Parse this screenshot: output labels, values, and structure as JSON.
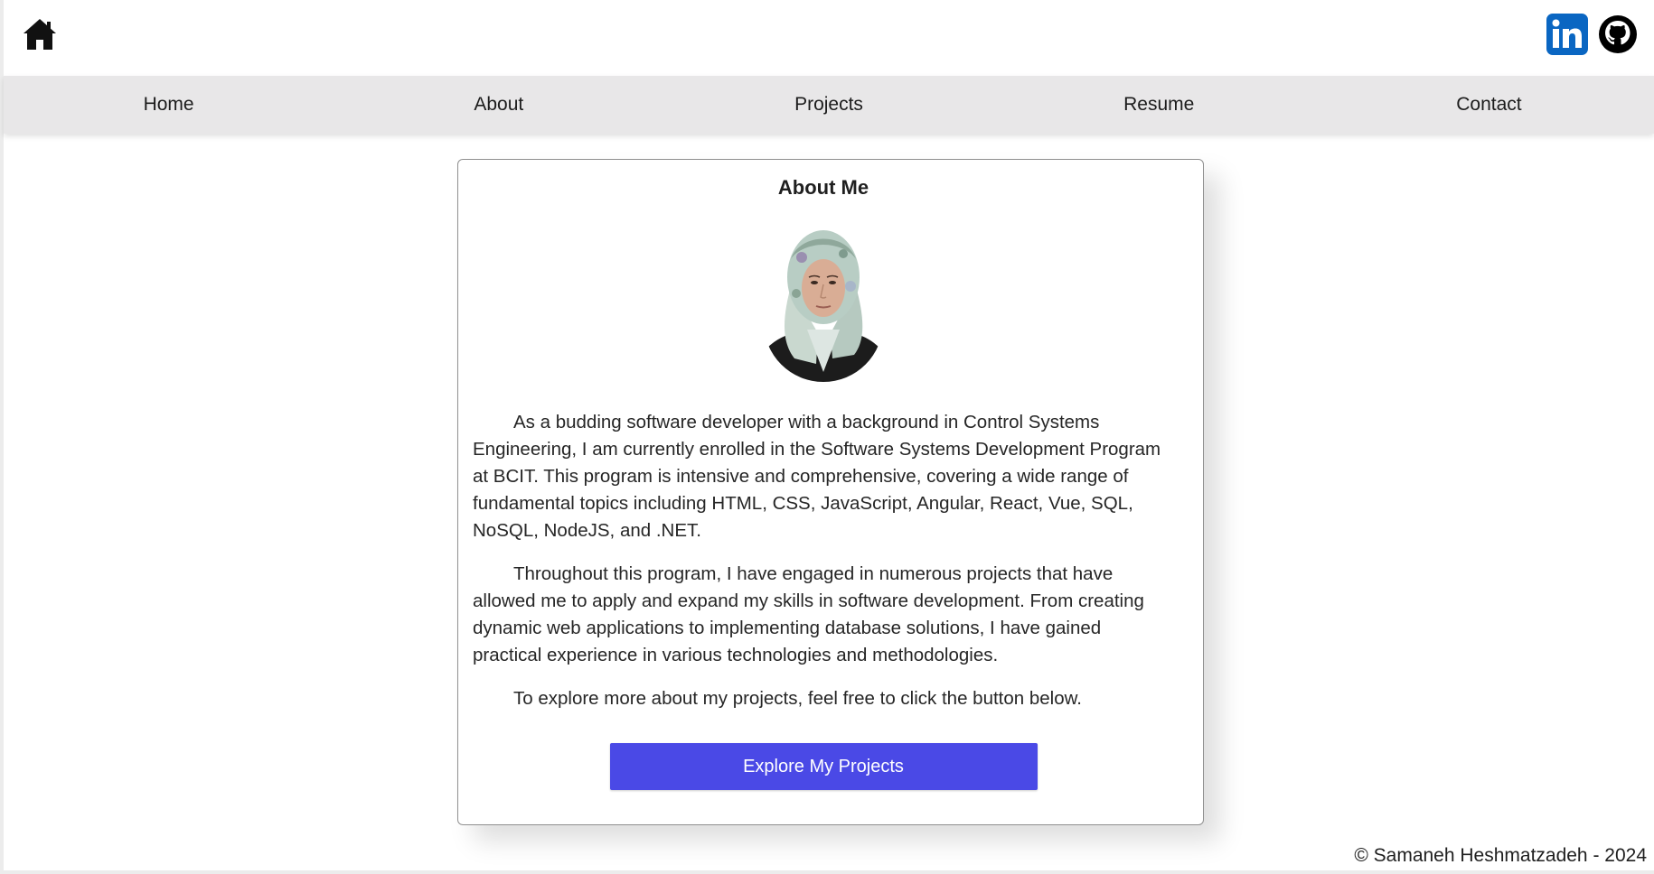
{
  "header": {
    "home_icon": "home-icon",
    "social": [
      {
        "name": "linkedin-icon",
        "color": "#0a66c2"
      },
      {
        "name": "github-icon",
        "color": "#000000"
      }
    ]
  },
  "nav": {
    "items": [
      {
        "label": "Home"
      },
      {
        "label": "About"
      },
      {
        "label": "Projects"
      },
      {
        "label": "Resume"
      },
      {
        "label": "Contact"
      }
    ],
    "background": "#e8e7e8"
  },
  "about": {
    "title": "About Me",
    "paragraphs": [
      "As a budding software developer with a background in Control Systems Engineering, I am currently enrolled in the Software Systems Development Program at BCIT. This program is intensive and comprehensive, covering a wide range of fundamental topics including HTML, CSS, JavaScript, Angular, React, Vue, SQL, NoSQL, NodeJS, and .NET.",
      "Throughout this program, I have engaged in numerous projects that have allowed me to apply and expand my skills in software development. From creating dynamic web applications to implementing database solutions, I have gained practical experience in various technologies and methodologies.",
      "To explore more about my projects, feel free to click the button below."
    ],
    "cta_label": "Explore My Projects",
    "cta_color": "#4a49e6"
  },
  "footer": {
    "text": "© Samaneh Heshmatzadeh - 2024"
  }
}
